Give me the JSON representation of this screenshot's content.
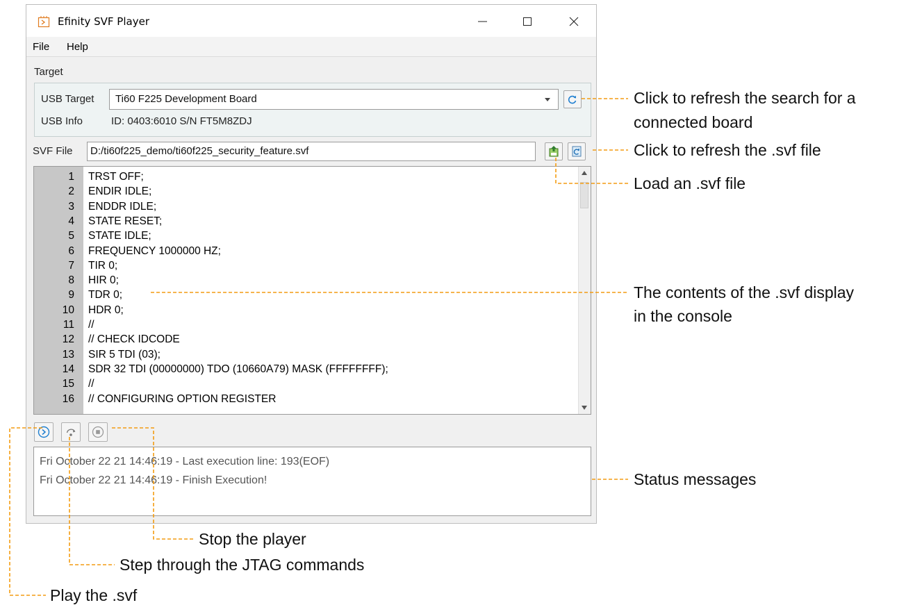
{
  "window": {
    "title": "Efinity SVF Player",
    "menu": [
      "File",
      "Help"
    ]
  },
  "target": {
    "group_label": "Target",
    "usb_target_label": "USB Target",
    "usb_target_value": "Ti60 F225 Development Board",
    "usb_info_label": "USB Info",
    "usb_info_value": "ID: 0403:6010 S/N FT5M8ZDJ"
  },
  "svf": {
    "label": "SVF File",
    "path": "D:/ti60f225_demo/ti60f225_security_feature.svf"
  },
  "console": {
    "lines": [
      {
        "n": "1",
        "text": "TRST OFF;"
      },
      {
        "n": "2",
        "text": "ENDIR IDLE;"
      },
      {
        "n": "3",
        "text": "ENDDR IDLE;"
      },
      {
        "n": "4",
        "text": "STATE RESET;"
      },
      {
        "n": "5",
        "text": "STATE IDLE;"
      },
      {
        "n": "6",
        "text": "FREQUENCY 1000000 HZ;"
      },
      {
        "n": "7",
        "text": "TIR 0;"
      },
      {
        "n": "8",
        "text": "HIR 0;"
      },
      {
        "n": "9",
        "text": "TDR 0;"
      },
      {
        "n": "10",
        "text": "HDR 0;"
      },
      {
        "n": "11",
        "text": "//"
      },
      {
        "n": "12",
        "text": "// CHECK IDCODE"
      },
      {
        "n": "13",
        "text": "SIR 5 TDI (03);"
      },
      {
        "n": "14",
        "text": "SDR 32 TDI (00000000) TDO (10660A79) MASK (FFFFFFFF);"
      },
      {
        "n": "15",
        "text": "//"
      },
      {
        "n": "16",
        "text": "// CONFIGURING OPTION REGISTER"
      }
    ]
  },
  "status": {
    "messages": [
      "Fri October 22 21 14:46:19 - Last execution line: 193(EOF)",
      "Fri October 22 21 14:46:19 - Finish Execution!"
    ]
  },
  "callouts": {
    "refresh_board_1": "Click to refresh the search for a",
    "refresh_board_2": "connected board",
    "refresh_svf": "Click to refresh the .svf file",
    "load_svf": "Load an .svf file",
    "console_1": "The contents of the .svf display",
    "console_2": "in the console",
    "status": "Status messages",
    "stop": "Stop the player",
    "step": "Step through the JTAG commands",
    "play": "Play the .svf"
  },
  "colors": {
    "accent": "#1f7fd0",
    "callout_line": "#f39c12",
    "gutter": "#c7c7c7"
  }
}
